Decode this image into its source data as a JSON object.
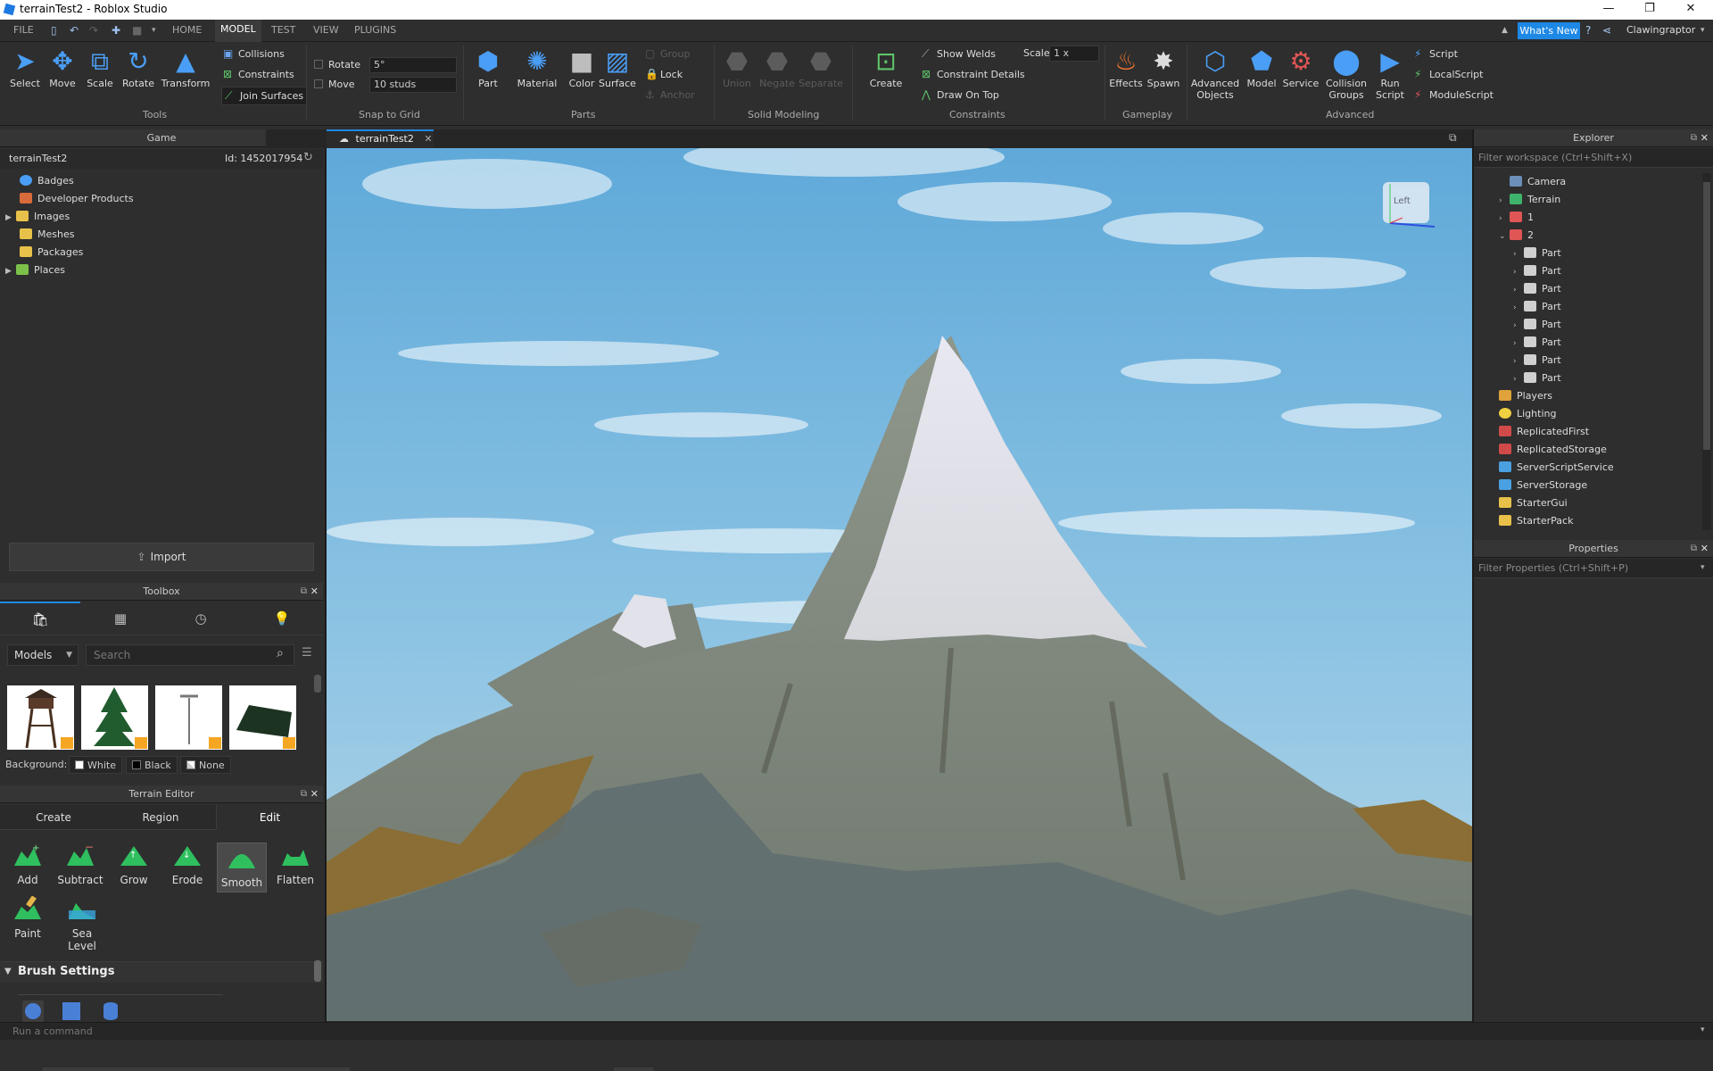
{
  "window": {
    "title": "terrainTest2 - Roblox Studio",
    "controls": [
      "—",
      "❐",
      "✕"
    ]
  },
  "menu": {
    "items": [
      "FILE",
      "HOME",
      "MODEL",
      "TEST",
      "VIEW",
      "PLUGINS"
    ],
    "active": "MODEL",
    "whats_new": "What's New",
    "username": "Clawingraptor"
  },
  "ribbon": {
    "tools": {
      "select": "Select",
      "move": "Move",
      "scale": "Scale",
      "rotate": "Rotate",
      "transform": "Transform",
      "collisions": "Collisions",
      "constraints": "Constraints",
      "join_surfaces": "Join Surfaces",
      "label": "Tools"
    },
    "snap": {
      "rotate_label": "Rotate",
      "rotate_value": "5°",
      "move_label": "Move",
      "move_value": "10 studs",
      "label": "Snap to Grid"
    },
    "parts": {
      "part": "Part",
      "material": "Material",
      "color": "Color",
      "surface": "Surface",
      "group": "Group",
      "lock": "Lock",
      "anchor": "Anchor",
      "label": "Parts"
    },
    "solid": {
      "union": "Union",
      "negate": "Negate",
      "separate": "Separate",
      "label": "Solid Modeling"
    },
    "constraints": {
      "create": "Create",
      "show_welds": "Show Welds",
      "constraint_details": "Constraint Details",
      "draw_on_top": "Draw On Top",
      "scale_label": "Scale",
      "scale_value": "1 x",
      "label": "Constraints"
    },
    "gameplay": {
      "effects": "Effects",
      "spawn": "Spawn",
      "label": "Gameplay"
    },
    "advanced": {
      "advanced_objects_1": "Advanced",
      "advanced_objects_2": "Objects",
      "model": "Model",
      "service": "Service",
      "collision_1": "Collision",
      "collision_2": "Groups",
      "run_1": "Run",
      "run_2": "Script",
      "script": "Script",
      "local_script": "LocalScript",
      "module_script": "ModuleScript",
      "label": "Advanced"
    }
  },
  "game_panel": {
    "title": "Game",
    "place_name": "terrainTest2",
    "place_id": "Id: 1452017954",
    "items": [
      "Badges",
      "Developer Products",
      "Images",
      "Meshes",
      "Packages",
      "Places"
    ],
    "import": "Import"
  },
  "toolbox": {
    "title": "Toolbox",
    "category": "Models",
    "search_placeholder": "Search",
    "background_label": "Background:",
    "bg_options": [
      "White",
      "Black",
      "None"
    ]
  },
  "terrain_editor": {
    "title": "Terrain Editor",
    "tabs": [
      "Create",
      "Region",
      "Edit"
    ],
    "active_tab": "Edit",
    "tools": [
      "Add",
      "Subtract",
      "Grow",
      "Erode",
      "Smooth",
      "Flatten",
      "Paint",
      "Sea Level"
    ],
    "active_tool": "Smooth",
    "brush_settings": "Brush Settings"
  },
  "document_tab": "terrainTest2",
  "viewcube_label": "Left",
  "explorer": {
    "title": "Explorer",
    "filter_placeholder": "Filter workspace (Ctrl+Shift+X)",
    "items": [
      "Camera",
      "Terrain",
      "1",
      "2",
      "Part",
      "Part",
      "Part",
      "Part",
      "Part",
      "Part",
      "Part",
      "Part",
      "Players",
      "Lighting",
      "ReplicatedFirst",
      "ReplicatedStorage",
      "ServerScriptService",
      "ServerStorage",
      "StarterGui",
      "StarterPack"
    ]
  },
  "properties": {
    "title": "Properties",
    "filter_placeholder": "Filter Properties (Ctrl+Shift+P)"
  },
  "command_bar": {
    "placeholder": "Run a command"
  },
  "colors": {
    "accent": "#1e88e5",
    "panel": "#2e2e2e",
    "header": "#353535"
  }
}
